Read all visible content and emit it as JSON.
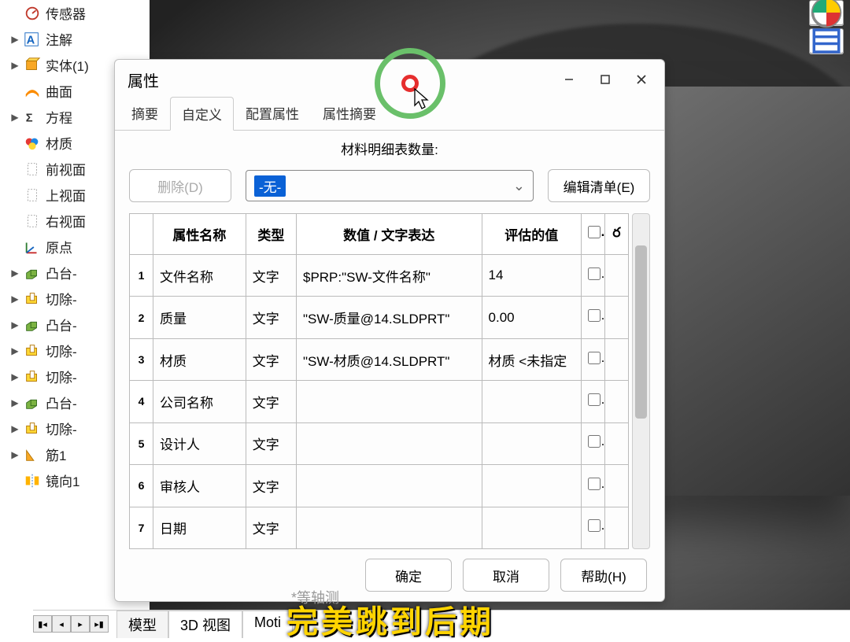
{
  "tree": {
    "items": [
      {
        "label": "传感器",
        "icon": "sensor",
        "arrow": false
      },
      {
        "label": "注解",
        "icon": "annotation",
        "arrow": true
      },
      {
        "label": "实体(1)",
        "icon": "solidbody",
        "arrow": true
      },
      {
        "label": "曲面",
        "icon": "surface",
        "arrow": false
      },
      {
        "label": "方程",
        "icon": "equation",
        "arrow": true
      },
      {
        "label": "材质",
        "icon": "material",
        "arrow": false
      },
      {
        "label": "前视面",
        "icon": "plane",
        "arrow": false
      },
      {
        "label": "上视面",
        "icon": "plane",
        "arrow": false
      },
      {
        "label": "右视面",
        "icon": "plane",
        "arrow": false
      },
      {
        "label": "原点",
        "icon": "origin",
        "arrow": false
      },
      {
        "label": "凸台-",
        "icon": "extrude",
        "arrow": true
      },
      {
        "label": "切除-",
        "icon": "cut",
        "arrow": true
      },
      {
        "label": "凸台-",
        "icon": "extrude",
        "arrow": true
      },
      {
        "label": "切除-",
        "icon": "cut",
        "arrow": true
      },
      {
        "label": "切除-",
        "icon": "cut",
        "arrow": true
      },
      {
        "label": "凸台-",
        "icon": "extrude",
        "arrow": true
      },
      {
        "label": "切除-",
        "icon": "cut",
        "arrow": true
      },
      {
        "label": "筋1",
        "icon": "rib",
        "arrow": true
      },
      {
        "label": "镜向1",
        "icon": "mirror",
        "arrow": false
      }
    ]
  },
  "dialog": {
    "title": "属性",
    "tabs": [
      "摘要",
      "自定义",
      "配置属性",
      "属性摘要"
    ],
    "active_tab": 1,
    "bom_label": "材料明细表数量:",
    "delete_btn": "删除(D)",
    "combo_value": "-无-",
    "edit_list_btn": "编辑清单(E)",
    "headers": {
      "name": "属性名称",
      "type": "类型",
      "value": "数值 / 文字表达",
      "eval": "评估的值",
      "link": "ర"
    },
    "rows": [
      {
        "n": "1",
        "name": "文件名称",
        "type": "文字",
        "value": "$PRP:\"SW-文件名称\"",
        "eval": "14"
      },
      {
        "n": "2",
        "name": "质量",
        "type": "文字",
        "value": "\"SW-质量@14.SLDPRT\"",
        "eval": "0.00"
      },
      {
        "n": "3",
        "name": "材质",
        "type": "文字",
        "value": "\"SW-材质@14.SLDPRT\"",
        "eval": "材质 <未指定"
      },
      {
        "n": "4",
        "name": "公司名称",
        "type": "文字",
        "value": "",
        "eval": ""
      },
      {
        "n": "5",
        "name": "设计人",
        "type": "文字",
        "value": "",
        "eval": ""
      },
      {
        "n": "6",
        "name": "审核人",
        "type": "文字",
        "value": "",
        "eval": ""
      },
      {
        "n": "7",
        "name": "日期",
        "type": "文字",
        "value": "",
        "eval": ""
      }
    ],
    "footer": {
      "ok": "确定",
      "cancel": "取消",
      "help": "帮助(H)"
    }
  },
  "bottom": {
    "tabs": [
      "模型",
      "3D 视图",
      "Moti"
    ],
    "iso": "*等轴测",
    "banner": "完美跳到后期"
  }
}
